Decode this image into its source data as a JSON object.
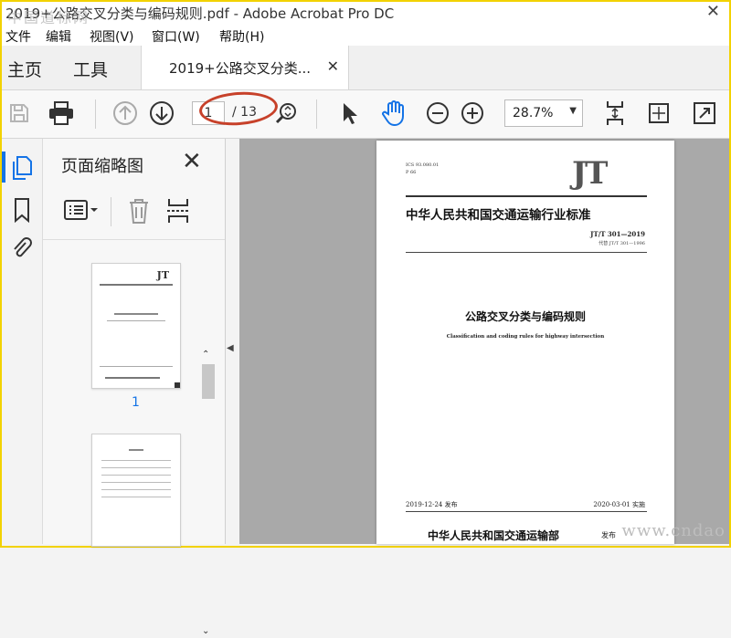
{
  "window": {
    "title": "2019+公路交叉分类与编码规则.pdf - Adobe Acrobat Pro DC",
    "watermark_top": "中国道标网",
    "watermark_bottom": "www.cndao"
  },
  "menu": [
    "文件",
    "编辑",
    "视图(V)",
    "窗口(W)",
    "帮助(H)"
  ],
  "tabs": {
    "home": "主页",
    "tools": "工具",
    "document": "2019+公路交叉分类..."
  },
  "toolbar": {
    "page_current": "1",
    "page_total": "/ 13",
    "zoom": "28.7%"
  },
  "panel": {
    "title": "页面缩略图",
    "thumbnail_1_label": "1"
  },
  "colors": {
    "accent": "#1473e6",
    "annotation_oval": "#c7412a",
    "frame": "#f2d200"
  },
  "document_page": {
    "ics": "ICS 93.080.01",
    "code": "P 66",
    "logo": "JT",
    "org_header": "中华人民共和国交通运输行业标准",
    "std_number": "JT/T 301—2019",
    "replaces": "代替 JT/T 301—1996",
    "title_cn": "公路交叉分类与编码规则",
    "title_en": "Classification and coding rules for highway intersection",
    "issued": "2019-12-24 发布",
    "effective": "2020-03-01 实施",
    "publisher": "中华人民共和国交通运输部",
    "publisher_suffix": "发布"
  }
}
